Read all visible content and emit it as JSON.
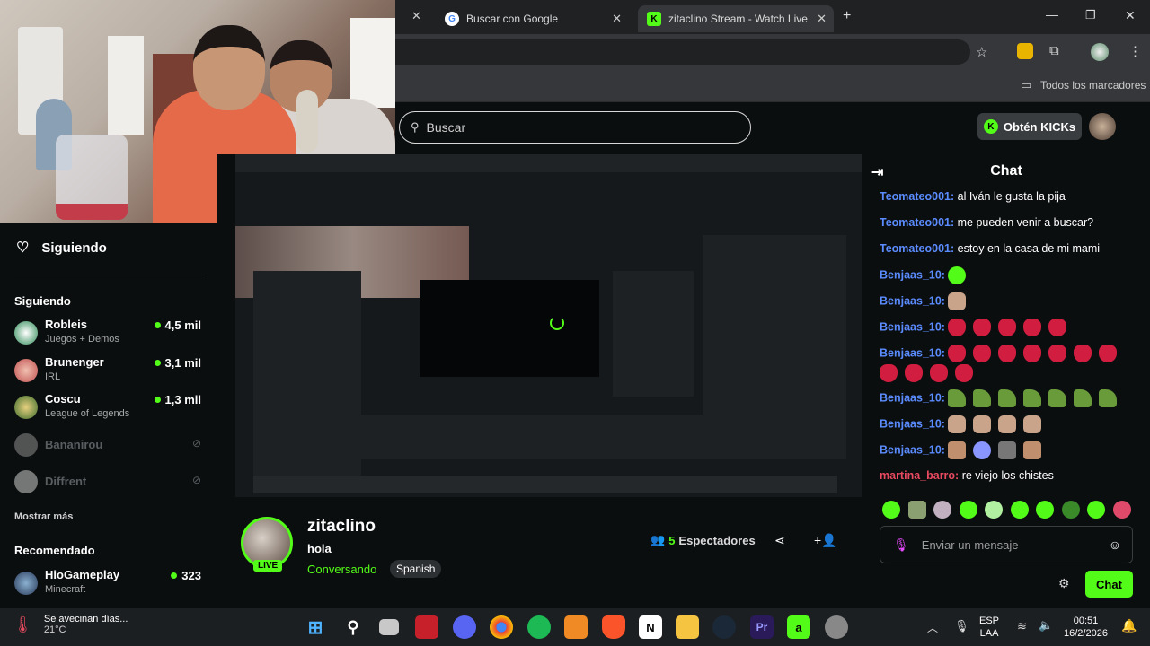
{
  "browser": {
    "tabs": [
      {
        "title": "Buscar con Google",
        "icon": "google-icon"
      },
      {
        "title": "zitaclino Stream - Watch Live o",
        "icon": "kick-icon"
      }
    ],
    "bookmarks_label": "Todos los marcadores"
  },
  "site": {
    "search_placeholder": "Buscar",
    "get_kicks_label": "Obtén KICKs"
  },
  "sidebar": {
    "following_header": "Siguiendo",
    "following_section": "Siguiendo",
    "channels": [
      {
        "name": "Robleis",
        "category": "Juegos + Demos",
        "viewers": "4,5 mil",
        "live": true
      },
      {
        "name": "Brunenger",
        "category": "IRL",
        "viewers": "3,1 mil",
        "live": true
      },
      {
        "name": "Coscu",
        "category": "League of Legends",
        "viewers": "1,3 mil",
        "live": true
      },
      {
        "name": "Bananirou",
        "category": "",
        "viewers": "",
        "live": false
      },
      {
        "name": "Diffrent",
        "category": "",
        "viewers": "",
        "live": false
      }
    ],
    "show_more": "Mostrar más",
    "recommended_section": "Recomendado",
    "recommended": [
      {
        "name": "HioGameplay",
        "category": "Minecraft",
        "viewers": "323"
      }
    ]
  },
  "stream": {
    "streamer": "zitaclino",
    "title": "hola",
    "category": "Conversando",
    "language": "Spanish",
    "live_badge": "LIVE",
    "viewer_count": "5",
    "viewer_label": "Espectadores"
  },
  "chat": {
    "header": "Chat",
    "messages": [
      {
        "user": "Teomateo001:",
        "text": "al Iván le gusta la pija"
      },
      {
        "user": "Teomateo001:",
        "text": "me pueden venir a buscar?"
      },
      {
        "user": "Teomateo001:",
        "text": "estoy en la casa de mi mami"
      },
      {
        "user": "Benjaas_10:",
        "text": ""
      },
      {
        "user": "Benjaas_10:",
        "text": ""
      },
      {
        "user": "Benjaas_10:",
        "text": ""
      },
      {
        "user": "Benjaas_10:",
        "text": ""
      },
      {
        "user": "Benjaas_10:",
        "text": ""
      },
      {
        "user": "Benjaas_10:",
        "text": ""
      },
      {
        "user": "Benjaas_10:",
        "text": ""
      },
      {
        "user": "martina_barro:",
        "text": "re viejo los chistes"
      }
    ],
    "input_placeholder": "Enviar un mensaje",
    "send_label": "Chat"
  },
  "taskbar": {
    "weather_text": "Se avecinan días...",
    "temperature": "21°C",
    "lang_top": "ESP",
    "lang_bottom": "LAA",
    "time": "00:51",
    "date": "16/2/2026"
  },
  "colors": {
    "accent": "#53fc18",
    "chat_user": "#5b8cff",
    "chat_user_alt": "#e84a5f"
  }
}
